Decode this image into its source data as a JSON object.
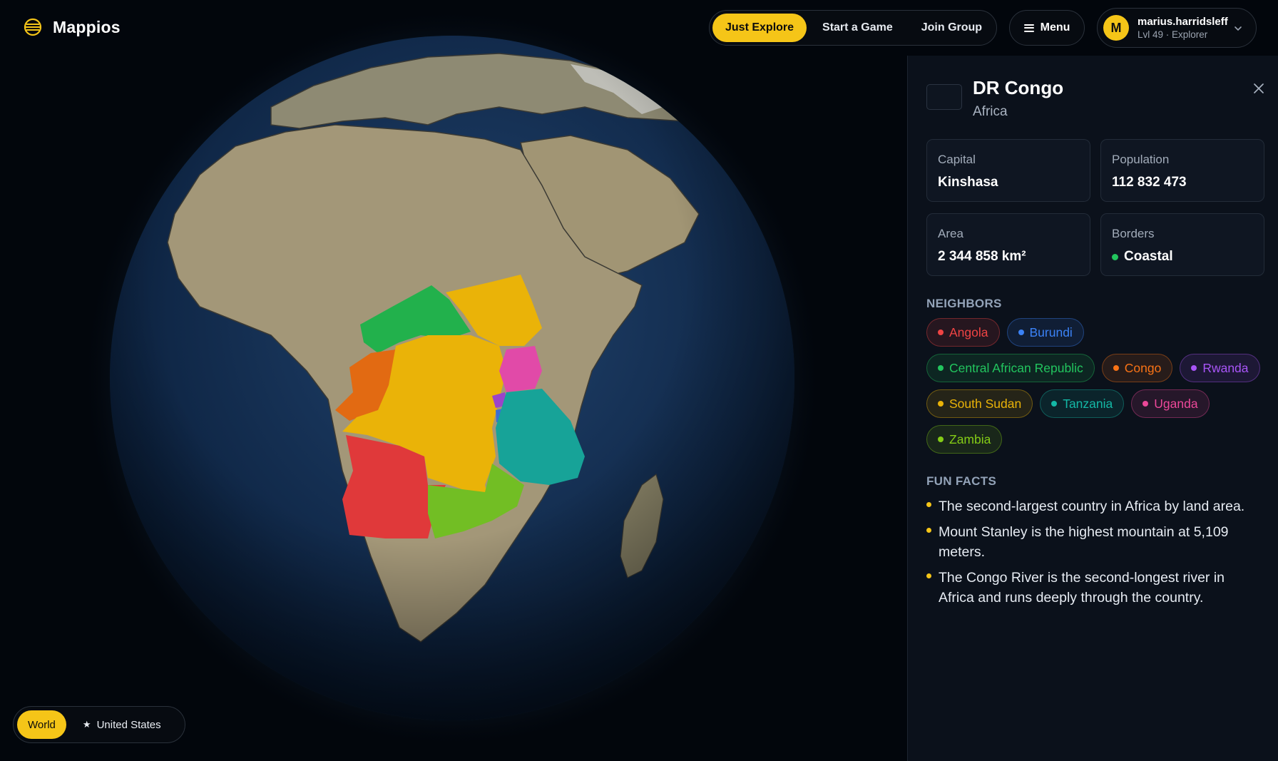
{
  "app": {
    "name": "Mappios",
    "logo_icon": "globe-logo-icon"
  },
  "modes": [
    {
      "label": "Just Explore",
      "active": true
    },
    {
      "label": "Start a Game",
      "active": false
    },
    {
      "label": "Join Group",
      "active": false
    }
  ],
  "menu": {
    "label": "Menu"
  },
  "user": {
    "initial": "M",
    "username": "marius.harridsleff",
    "level": "Lvl 49 · Explorer"
  },
  "region_switch": {
    "options": [
      {
        "label": "World",
        "active": true
      },
      {
        "label": "United States",
        "active": false,
        "icon": "star-icon"
      }
    ]
  },
  "panel": {
    "country": "DR Congo",
    "continent": "Africa",
    "stats": {
      "capital": {
        "label": "Capital",
        "value": "Kinshasa"
      },
      "population": {
        "label": "Population",
        "value": "112 832 473"
      },
      "area": {
        "label": "Area",
        "value": "2 344 858 km²"
      },
      "borders": {
        "label": "Borders",
        "value": "Coastal",
        "color": "#22c55e"
      }
    },
    "neighbors_title": "NEIGHBORS",
    "neighbors": [
      {
        "name": "Angola",
        "color": "#ef4444"
      },
      {
        "name": "Burundi",
        "color": "#3b82f6"
      },
      {
        "name": "Central African Republic",
        "color": "#22c55e"
      },
      {
        "name": "Congo",
        "color": "#f97316"
      },
      {
        "name": "Rwanda",
        "color": "#a855f7"
      },
      {
        "name": "South Sudan",
        "color": "#eab308"
      },
      {
        "name": "Tanzania",
        "color": "#14b8a6"
      },
      {
        "name": "Uganda",
        "color": "#ec4899"
      },
      {
        "name": "Zambia",
        "color": "#84cc16"
      }
    ],
    "fun_facts_title": "FUN FACTS",
    "fun_facts": [
      "The second-largest country in Africa by land area.",
      "Mount Stanley is the highest mountain at 5,109 meters.",
      "The Congo River is the second-longest river in Africa and runs deeply through the country."
    ]
  },
  "colors": {
    "accent": "#f5c518",
    "selected_country": "#eab308"
  }
}
